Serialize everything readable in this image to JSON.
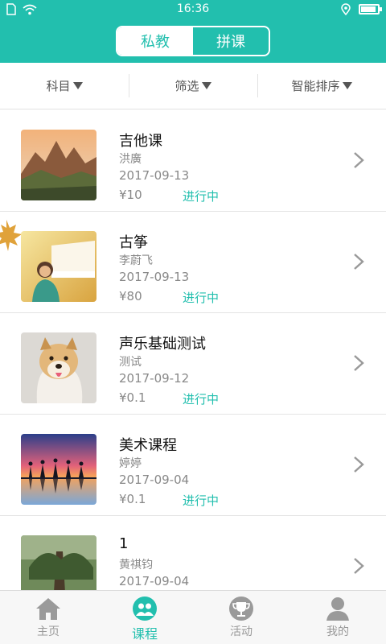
{
  "status_bar": {
    "time": "16:36"
  },
  "segments": [
    {
      "label": "私教",
      "active": true
    },
    {
      "label": "拼课",
      "active": false
    }
  ],
  "filters": [
    {
      "label": "科目"
    },
    {
      "label": "筛选"
    },
    {
      "label": "智能排序"
    }
  ],
  "courses": [
    {
      "title": "吉他课",
      "teacher": "洪廣",
      "date": "2017-09-13",
      "price": "¥10",
      "status": "进行中",
      "thumb": "mountain"
    },
    {
      "title": "古筝",
      "teacher": "李蔚飞",
      "date": "2017-09-13",
      "price": "¥80",
      "status": "进行中",
      "thumb": "piano"
    },
    {
      "title": "声乐基础测试",
      "teacher": "测试",
      "date": "2017-09-12",
      "price": "¥0.1",
      "status": "进行中",
      "thumb": "puppy"
    },
    {
      "title": "美术课程",
      "teacher": "婷婷",
      "date": "2017-09-04",
      "price": "¥0.1",
      "status": "进行中",
      "thumb": "sunset"
    },
    {
      "title": "1",
      "teacher": "黄祺钧",
      "date": "2017-09-04",
      "price": "",
      "status": "",
      "thumb": "forest"
    }
  ],
  "bottom_nav": [
    {
      "label": "主页",
      "icon": "home-icon",
      "active": false
    },
    {
      "label": "课程",
      "icon": "course-icon",
      "active": true
    },
    {
      "label": "活动",
      "icon": "trophy-icon",
      "active": false
    },
    {
      "label": "我的",
      "icon": "user-icon",
      "active": false
    }
  ],
  "colors": {
    "accent": "#22bfae",
    "muted_text": "#888888"
  }
}
